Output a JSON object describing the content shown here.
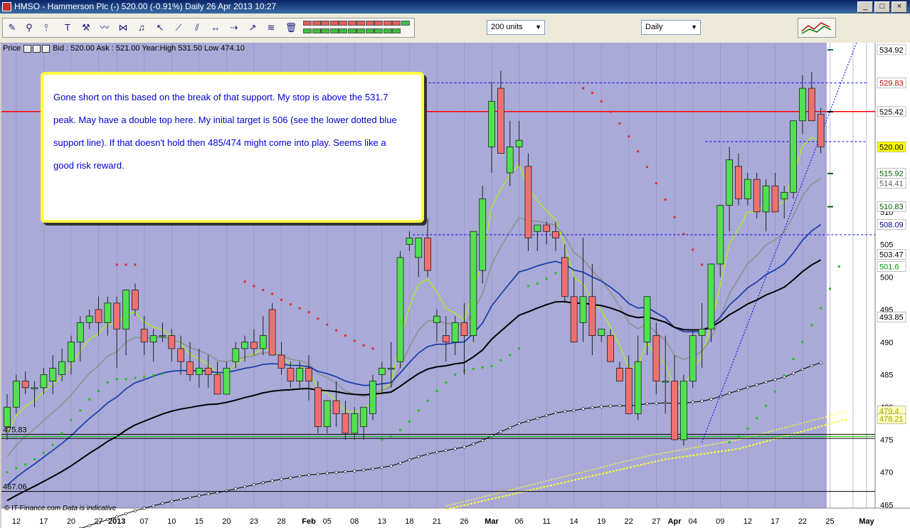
{
  "window": {
    "title": "HMSO - Hammerson Plc (-)      520.00 (-0.91%)      Daily  26 Apr 2013 10:27",
    "ctrl_min": "_",
    "ctrl_max": "□",
    "ctrl_close": "×"
  },
  "toolbar": {
    "units_dropdown": "200 units",
    "period_dropdown": "Daily",
    "drawing_colors": [
      "#e06060",
      "#e06060",
      "#e06060",
      "#e06060",
      "#e06060",
      "#e06060",
      "#e06060",
      "#e06060",
      "#e06060",
      "#e06060",
      "#e06060",
      "#40c040",
      "#40c040",
      "#40c040",
      "#40c040",
      "#40c040",
      "#40c040",
      "#40c040",
      "#40c040",
      "#40c040",
      "#40c040",
      "#40c040",
      "#40c040"
    ],
    "icons": [
      "pencil-icon",
      "magnifier-icon",
      "cursor-line-icon",
      "text-tool-icon",
      "tools-icon",
      "chart-line-icon",
      "chart-arrows-icon",
      "bell-icon",
      "arrow-pointer-icon",
      "trendline-icon",
      "parallel-lines-icon",
      "horizontal-line-icon",
      "arrow-line-icon",
      "fibonacci-icon",
      "trash-icon"
    ]
  },
  "price_bar": {
    "label": "Price",
    "info": "Bid : 520.00 Ask : 521.00 Year:High 531.50 Low 474.10"
  },
  "annotation": {
    "text": "Gone short on this based on the break of that support. My stop is above the 531.7 peak. May have a double top here. My initial target is 506 (see the lower dotted blue support line). If that doesn't hold then 485/474 might come into play. Seems like a good risk reward."
  },
  "footer": {
    "source": "© IT-Finance.com",
    "note": "Data is indicative"
  },
  "chart_data": {
    "type": "candlestick",
    "title": "HMSO - Hammerson Plc (-)",
    "xlabel": "",
    "ylabel": "",
    "ylim": [
      464.5,
      536
    ],
    "grid": false,
    "y_ticks": [
      465,
      470,
      475,
      480,
      485,
      490,
      495,
      500,
      505,
      510
    ],
    "x_ticks": [
      {
        "label": "12",
        "i": 1
      },
      {
        "label": "17",
        "i": 4
      },
      {
        "label": "20",
        "i": 7
      },
      {
        "label": "27",
        "i": 10
      },
      {
        "label": "2013",
        "i": 12
      },
      {
        "label": "07",
        "i": 15
      },
      {
        "label": "10",
        "i": 18
      },
      {
        "label": "15",
        "i": 21
      },
      {
        "label": "20",
        "i": 24
      },
      {
        "label": "23",
        "i": 27
      },
      {
        "label": "28",
        "i": 30
      },
      {
        "label": "Feb",
        "i": 33
      },
      {
        "label": "05",
        "i": 35
      },
      {
        "label": "08",
        "i": 38
      },
      {
        "label": "13",
        "i": 41
      },
      {
        "label": "18",
        "i": 44
      },
      {
        "label": "21",
        "i": 47
      },
      {
        "label": "26",
        "i": 50
      },
      {
        "label": "Mar",
        "i": 53
      },
      {
        "label": "06",
        "i": 56
      },
      {
        "label": "11",
        "i": 59
      },
      {
        "label": "14",
        "i": 62
      },
      {
        "label": "19",
        "i": 65
      },
      {
        "label": "22",
        "i": 68
      },
      {
        "label": "27",
        "i": 71
      },
      {
        "label": "Apr",
        "i": 73
      },
      {
        "label": "04",
        "i": 75
      },
      {
        "label": "09",
        "i": 78
      },
      {
        "label": "12",
        "i": 81
      },
      {
        "label": "17",
        "i": 84
      },
      {
        "label": "22",
        "i": 87
      },
      {
        "label": "25",
        "i": 90
      },
      {
        "label": "May",
        "i": 94
      }
    ],
    "price_labels": [
      {
        "value": 534.92,
        "text": "534.92",
        "bg": "#ffffff",
        "color": "#000000"
      },
      {
        "value": 529.83,
        "text": "529.83",
        "bg": "#ffffff",
        "color": "#d00000"
      },
      {
        "value": 525.42,
        "text": "525.42",
        "bg": "#ffffff",
        "color": "#000000"
      },
      {
        "value": 520.0,
        "text": "520.00",
        "bg": "#ffff00",
        "color": "#000000"
      },
      {
        "value": 515.92,
        "text": "515.92",
        "bg": "#ffffff",
        "color": "#006000"
      },
      {
        "value": 514.41,
        "text": "514.41",
        "bg": "#ffffff",
        "color": "#606060"
      },
      {
        "value": 510.83,
        "text": "510.83",
        "bg": "#ffffff",
        "color": "#006000"
      },
      {
        "value": 508.09,
        "text": "508.09",
        "bg": "#ffffff",
        "color": "#00008b"
      },
      {
        "value": 503.47,
        "text": "503.47",
        "bg": "#ffffff",
        "color": "#000000"
      },
      {
        "value": 501.6,
        "text": "501.6",
        "bg": "#ffffff",
        "color": "#00a000"
      },
      {
        "value": 493.85,
        "text": "493.85",
        "bg": "#ffffff",
        "color": "#000000"
      },
      {
        "value": 479.4,
        "text": "479.4",
        "bg": "#ffffc0",
        "color": "#a0a000"
      },
      {
        "value": 478.21,
        "text": "478.21",
        "bg": "#ffffc0",
        "color": "#a0a000"
      }
    ],
    "left_labels": [
      {
        "value": 475.83,
        "text": "475.83"
      },
      {
        "value": 467.06,
        "text": "467.06"
      }
    ],
    "horizontal_lines": [
      {
        "y": 525.42,
        "color": "#ff0000",
        "style": "solid",
        "width": 1.5,
        "from_i": 0,
        "to_i": 98
      },
      {
        "y": 529.83,
        "color": "#0000ff",
        "style": "dashed",
        "from_i": 43,
        "to_i": 94
      },
      {
        "y": 520.8,
        "color": "#0000ff",
        "style": "dashed",
        "from_i": 77,
        "to_i": 94
      },
      {
        "y": 506.5,
        "color": "#0000ff",
        "style": "dashed",
        "from_i": 45,
        "to_i": 98
      },
      {
        "y": 475.83,
        "color": "#000000",
        "style": "solid",
        "from_i": 0,
        "to_i": 98
      },
      {
        "y": 475.5,
        "color": "#00c000",
        "style": "solid",
        "from_i": 0,
        "to_i": 98
      },
      {
        "y": 475.2,
        "color": "#000000",
        "style": "solid",
        "from_i": 0,
        "to_i": 98
      },
      {
        "y": 467.06,
        "color": "#000000",
        "style": "solid",
        "from_i": 0,
        "to_i": 98
      }
    ],
    "trendlines": [
      {
        "from": [
          76,
          474.6
        ],
        "to": [
          94,
          540
        ],
        "color": "#0000ff",
        "style": "dotted"
      }
    ],
    "candles": [
      {
        "o": 477,
        "h": 482,
        "l": 475,
        "c": 480
      },
      {
        "o": 480,
        "h": 485,
        "l": 479,
        "c": 484
      },
      {
        "o": 484,
        "h": 485.5,
        "l": 482,
        "c": 483
      },
      {
        "o": 483,
        "h": 484,
        "l": 480,
        "c": 483
      },
      {
        "o": 483,
        "h": 486,
        "l": 482,
        "c": 485
      },
      {
        "o": 484,
        "h": 488,
        "l": 482,
        "c": 486
      },
      {
        "o": 485,
        "h": 489,
        "l": 484,
        "c": 487
      },
      {
        "o": 487,
        "h": 491,
        "l": 485,
        "c": 490
      },
      {
        "o": 490,
        "h": 494,
        "l": 487,
        "c": 493
      },
      {
        "o": 493,
        "h": 495,
        "l": 492,
        "c": 494
      },
      {
        "o": 495,
        "h": 497,
        "l": 491,
        "c": 493
      },
      {
        "o": 493,
        "h": 497,
        "l": 491,
        "c": 496
      },
      {
        "o": 496,
        "h": 497,
        "l": 486,
        "c": 492
      },
      {
        "o": 492,
        "h": 497,
        "l": 488,
        "c": 498
      },
      {
        "o": 498,
        "h": 499,
        "l": 494,
        "c": 495
      },
      {
        "o": 492,
        "h": 494,
        "l": 488,
        "c": 490
      },
      {
        "o": 490,
        "h": 492,
        "l": 487,
        "c": 491
      },
      {
        "o": 491,
        "h": 493,
        "l": 490,
        "c": 491
      },
      {
        "o": 491,
        "h": 492,
        "l": 487,
        "c": 489
      },
      {
        "o": 489,
        "h": 491,
        "l": 485,
        "c": 487
      },
      {
        "o": 487,
        "h": 490,
        "l": 484,
        "c": 485
      },
      {
        "o": 485,
        "h": 489,
        "l": 483,
        "c": 486
      },
      {
        "o": 486,
        "h": 488,
        "l": 483,
        "c": 485
      },
      {
        "o": 485,
        "h": 487,
        "l": 482,
        "c": 482
      },
      {
        "o": 482,
        "h": 487,
        "l": 482,
        "c": 486
      },
      {
        "o": 487,
        "h": 490,
        "l": 486,
        "c": 489
      },
      {
        "o": 489,
        "h": 491,
        "l": 487,
        "c": 490
      },
      {
        "o": 490,
        "h": 492,
        "l": 488,
        "c": 489
      },
      {
        "o": 489,
        "h": 494,
        "l": 488,
        "c": 491
      },
      {
        "o": 495,
        "h": 496,
        "l": 488,
        "c": 488
      },
      {
        "o": 488,
        "h": 490,
        "l": 485,
        "c": 486
      },
      {
        "o": 486,
        "h": 487,
        "l": 483,
        "c": 484
      },
      {
        "o": 484,
        "h": 487,
        "l": 483,
        "c": 486
      },
      {
        "o": 486,
        "h": 488,
        "l": 481,
        "c": 484
      },
      {
        "o": 483,
        "h": 484,
        "l": 476,
        "c": 477
      },
      {
        "o": 477,
        "h": 481,
        "l": 476,
        "c": 481
      },
      {
        "o": 481,
        "h": 484,
        "l": 477,
        "c": 479
      },
      {
        "o": 479,
        "h": 481,
        "l": 475,
        "c": 476
      },
      {
        "o": 476,
        "h": 480,
        "l": 475,
        "c": 479
      },
      {
        "o": 477,
        "h": 480,
        "l": 475,
        "c": 480
      },
      {
        "o": 479,
        "h": 485,
        "l": 478,
        "c": 484
      },
      {
        "o": 485,
        "h": 487,
        "l": 482,
        "c": 486
      },
      {
        "o": 486,
        "h": 490,
        "l": 483,
        "c": 486
      },
      {
        "o": 487,
        "h": 504,
        "l": 486,
        "c": 503
      },
      {
        "o": 505,
        "h": 507,
        "l": 504,
        "c": 506
      },
      {
        "o": 503,
        "h": 506,
        "l": 500,
        "c": 506
      },
      {
        "o": 506,
        "h": 509,
        "l": 500,
        "c": 501
      },
      {
        "o": 493,
        "h": 495,
        "l": 490,
        "c": 494
      },
      {
        "o": 491,
        "h": 494,
        "l": 487,
        "c": 490
      },
      {
        "o": 490,
        "h": 494,
        "l": 488,
        "c": 493
      },
      {
        "o": 493,
        "h": 496,
        "l": 485,
        "c": 491
      },
      {
        "o": 491,
        "h": 507,
        "l": 490,
        "c": 507
      },
      {
        "o": 501,
        "h": 514,
        "l": 499,
        "c": 512
      },
      {
        "o": 520,
        "h": 530,
        "l": 516,
        "c": 527
      },
      {
        "o": 529,
        "h": 531.7,
        "l": 524,
        "c": 519
      },
      {
        "o": 516,
        "h": 524,
        "l": 514,
        "c": 520
      },
      {
        "o": 520,
        "h": 524,
        "l": 517,
        "c": 521
      },
      {
        "o": 517,
        "h": 519,
        "l": 504,
        "c": 506
      },
      {
        "o": 507,
        "h": 508,
        "l": 504,
        "c": 508
      },
      {
        "o": 508,
        "h": 508.5,
        "l": 505,
        "c": 507
      },
      {
        "o": 507,
        "h": 508.5,
        "l": 504,
        "c": 506
      },
      {
        "o": 503,
        "h": 505,
        "l": 496,
        "c": 497
      },
      {
        "o": 497,
        "h": 500,
        "l": 490,
        "c": 490
      },
      {
        "o": 493,
        "h": 506,
        "l": 490,
        "c": 497
      },
      {
        "o": 497,
        "h": 502,
        "l": 488,
        "c": 491
      },
      {
        "o": 491,
        "h": 492,
        "l": 490,
        "c": 492
      },
      {
        "o": 491,
        "h": 492,
        "l": 487,
        "c": 487
      },
      {
        "o": 486,
        "h": 487,
        "l": 484,
        "c": 484
      },
      {
        "o": 486,
        "h": 488,
        "l": 479,
        "c": 479
      },
      {
        "o": 479,
        "h": 491,
        "l": 478,
        "c": 487
      },
      {
        "o": 490,
        "h": 497,
        "l": 488,
        "c": 497
      },
      {
        "o": 491,
        "h": 493,
        "l": 482,
        "c": 484
      },
      {
        "o": 484,
        "h": 491,
        "l": 479,
        "c": 484
      },
      {
        "o": 484,
        "h": 488,
        "l": 475,
        "c": 475
      },
      {
        "o": 475,
        "h": 485,
        "l": 474.1,
        "c": 484
      },
      {
        "o": 484,
        "h": 492,
        "l": 483,
        "c": 491
      },
      {
        "o": 491,
        "h": 496,
        "l": 486,
        "c": 492
      },
      {
        "o": 492,
        "h": 502,
        "l": 490,
        "c": 502
      },
      {
        "o": 502,
        "h": 511,
        "l": 500,
        "c": 511
      },
      {
        "o": 511,
        "h": 520,
        "l": 507,
        "c": 518
      },
      {
        "o": 517,
        "h": 519,
        "l": 511,
        "c": 512
      },
      {
        "o": 512,
        "h": 516,
        "l": 511,
        "c": 515
      },
      {
        "o": 515,
        "h": 516,
        "l": 509,
        "c": 510
      },
      {
        "o": 510,
        "h": 515,
        "l": 507,
        "c": 514
      },
      {
        "o": 514,
        "h": 516,
        "l": 510,
        "c": 510
      },
      {
        "o": 512,
        "h": 514,
        "l": 509,
        "c": 513
      },
      {
        "o": 513,
        "h": 524,
        "l": 512,
        "c": 524
      },
      {
        "o": 524,
        "h": 531,
        "l": 522,
        "c": 529
      },
      {
        "o": 529,
        "h": 531.5,
        "l": 524,
        "c": 524
      },
      {
        "o": 525,
        "h": 526,
        "l": 519,
        "c": 520
      }
    ],
    "sar_red": [
      [
        12,
        501.9
      ],
      [
        13,
        501.9
      ],
      [
        14,
        501.9
      ],
      [
        26,
        499.3
      ],
      [
        27,
        498.6
      ],
      [
        28,
        498
      ],
      [
        29,
        497.4
      ],
      [
        30,
        496.5
      ],
      [
        31,
        495.8
      ],
      [
        32,
        495.2
      ],
      [
        33,
        494.6
      ],
      [
        34,
        493.6
      ],
      [
        35,
        492.7
      ],
      [
        36,
        491.8
      ],
      [
        37,
        491
      ],
      [
        38,
        490.2
      ],
      [
        39,
        489.5
      ],
      [
        40,
        489
      ],
      [
        63,
        529
      ],
      [
        64,
        528.3
      ],
      [
        65,
        527
      ],
      [
        66,
        525.4
      ],
      [
        67,
        523.6
      ],
      [
        68,
        521.6
      ],
      [
        69,
        519.3
      ],
      [
        70,
        516.9
      ],
      [
        71,
        514.4
      ],
      [
        72,
        511.9
      ],
      [
        73,
        509.2
      ],
      [
        74,
        506.6
      ],
      [
        75,
        504.2
      ],
      [
        76,
        501.9
      ],
      [
        77,
        499.6
      ]
    ],
    "sar_green": [
      [
        0,
        470
      ],
      [
        1,
        470.6
      ],
      [
        2,
        471.2
      ],
      [
        3,
        472
      ],
      [
        4,
        473
      ],
      [
        5,
        474.2
      ],
      [
        6,
        476
      ],
      [
        7,
        478
      ],
      [
        8,
        479.5
      ],
      [
        9,
        481.2
      ],
      [
        10,
        482.5
      ],
      [
        11,
        483.8
      ],
      [
        12,
        484.3
      ],
      [
        13,
        484.3
      ],
      [
        14,
        484.5
      ],
      [
        15,
        484.7
      ],
      [
        16,
        484.9
      ],
      [
        17,
        485.1
      ],
      [
        41,
        475
      ],
      [
        42,
        475.5
      ],
      [
        43,
        476.5
      ],
      [
        44,
        477.8
      ],
      [
        45,
        479.5
      ],
      [
        46,
        481
      ],
      [
        47,
        482.5
      ],
      [
        48,
        483.8
      ],
      [
        49,
        485
      ],
      [
        50,
        485.6
      ],
      [
        51,
        485.9
      ],
      [
        52,
        486.1
      ],
      [
        53,
        486.3
      ],
      [
        54,
        487.2
      ],
      [
        55,
        488
      ],
      [
        56,
        489
      ],
      [
        57,
        498.6
      ],
      [
        58,
        499
      ],
      [
        59,
        499.7
      ],
      [
        60,
        500.6
      ],
      [
        61,
        501.4
      ],
      [
        79,
        474.6
      ],
      [
        80,
        475.5
      ],
      [
        81,
        476.7
      ],
      [
        82,
        478.3
      ],
      [
        83,
        480.2
      ],
      [
        84,
        482.4
      ],
      [
        85,
        484.9
      ],
      [
        86,
        487.4
      ],
      [
        87,
        490
      ],
      [
        88,
        492.6
      ],
      [
        89,
        495.2
      ],
      [
        90,
        498.2
      ],
      [
        91,
        501.6
      ]
    ],
    "ma_colors": {
      "fast": "#a8f020",
      "mid": "#909090",
      "slow": "#1f3faa",
      "long": "#000000",
      "vlong": "#000000",
      "yellow": "#ffff30"
    },
    "bar_colors": {
      "up": "#50e050",
      "down": "#f07070",
      "edge": "#202020"
    },
    "background": {
      "plot": "#aaaad8",
      "right_panel": "#ffffff"
    }
  }
}
